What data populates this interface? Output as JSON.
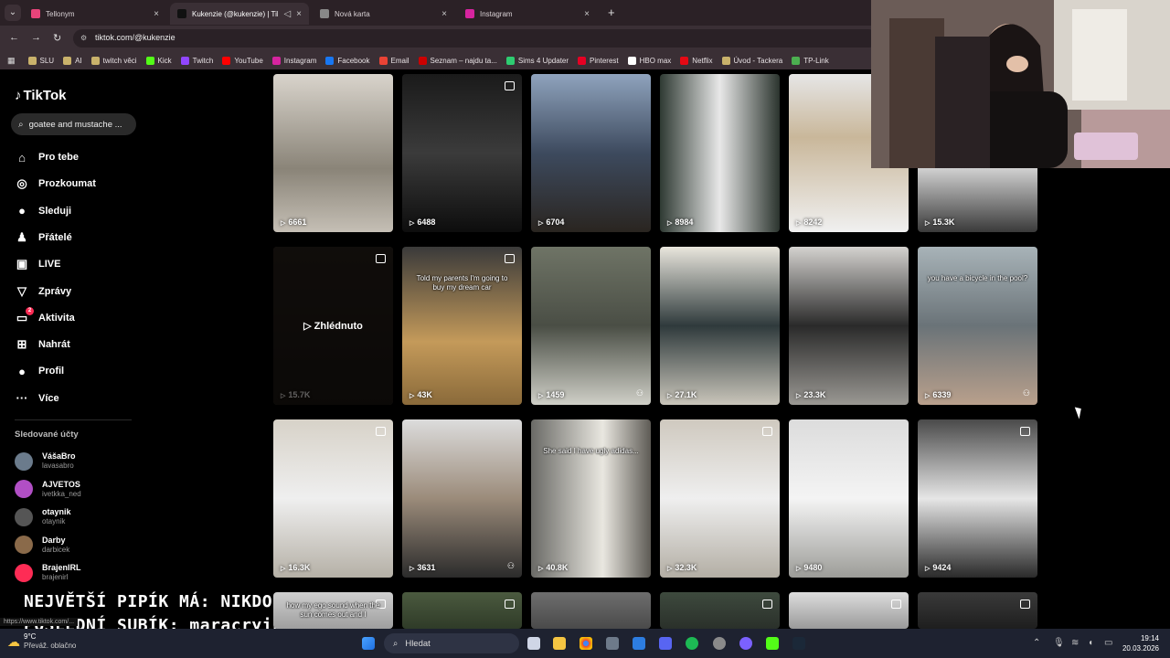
{
  "browser": {
    "tabs": [
      {
        "title": "Tellonym",
        "color": "#e8447a",
        "active": false
      },
      {
        "title": "Kukenzie (@kukenzie) | Tik",
        "color": "#111111",
        "active": true
      },
      {
        "title": "Nová karta",
        "color": "#888888",
        "active": false
      },
      {
        "title": "Instagram",
        "color": "#d6249f",
        "active": false
      }
    ],
    "url": "tiktok.com/@kukenzie",
    "bookmarks": [
      {
        "label": "SLU",
        "color": "#c9b26b"
      },
      {
        "label": "AI",
        "color": "#c9b26b"
      },
      {
        "label": "twitch věci",
        "color": "#c9b26b"
      },
      {
        "label": "Kick",
        "color": "#53fc18"
      },
      {
        "label": "Twitch",
        "color": "#9146ff"
      },
      {
        "label": "YouTube",
        "color": "#ff0000"
      },
      {
        "label": "Instagram",
        "color": "#d6249f"
      },
      {
        "label": "Facebook",
        "color": "#1877f2"
      },
      {
        "label": "Email",
        "color": "#ea4335"
      },
      {
        "label": "Seznam – najdu ta...",
        "color": "#cc0000"
      },
      {
        "label": "Sims 4 Updater",
        "color": "#2ecc71"
      },
      {
        "label": "Pinterest",
        "color": "#e60023"
      },
      {
        "label": "HBO max",
        "color": "#ffffff"
      },
      {
        "label": "Netflix",
        "color": "#e50914"
      },
      {
        "label": "Úvod - Tackera",
        "color": "#c9b26b"
      },
      {
        "label": "TP-Link",
        "color": "#4caf50"
      }
    ]
  },
  "tiktok": {
    "logo": "TikTok",
    "search_value": "goatee and mustache ...",
    "nav": [
      {
        "label": "Pro tebe",
        "icon": "home-icon",
        "glyph": "⌂"
      },
      {
        "label": "Prozkoumat",
        "icon": "compass-icon",
        "glyph": "◎"
      },
      {
        "label": "Sleduji",
        "icon": "avatar-icon",
        "glyph": "●"
      },
      {
        "label": "Přátelé",
        "icon": "friends-icon",
        "glyph": "♟"
      },
      {
        "label": "LIVE",
        "icon": "live-icon",
        "glyph": "▣"
      },
      {
        "label": "Zprávy",
        "icon": "send-icon",
        "glyph": "▽"
      },
      {
        "label": "Aktivita",
        "icon": "activity-icon",
        "glyph": "▭",
        "badge": "2"
      },
      {
        "label": "Nahrát",
        "icon": "upload-icon",
        "glyph": "⊞"
      },
      {
        "label": "Profil",
        "icon": "profile-icon",
        "glyph": "●"
      },
      {
        "label": "Více",
        "icon": "more-icon",
        "glyph": "···"
      }
    ],
    "following_heading": "Sledované účty",
    "following": [
      {
        "name": "VášaBro",
        "handle": "lavasabro",
        "color": "#6b7b8c"
      },
      {
        "name": "AJVETOS",
        "handle": "ivetkka_ned",
        "color": "#b14fc5"
      },
      {
        "name": "otaynik",
        "handle": "otaynik",
        "color": "#555555"
      },
      {
        "name": "Darby",
        "handle": "darbicek",
        "color": "#8a6a4a"
      },
      {
        "name": "BrajenIRL",
        "handle": "brajenirl",
        "color": "#fe2c55"
      }
    ],
    "videos": [
      {
        "plays": "6661",
        "bg": "linear-gradient(180deg,#d9d4cc,#8a8478 60%,#c5bfb5)",
        "caption": "",
        "pinned": false,
        "collab": false
      },
      {
        "plays": "6488",
        "bg": "linear-gradient(180deg,#1a1a1a,#3b3b3b 50%,#0d0d0d)",
        "caption": "",
        "pinned": true,
        "collab": false
      },
      {
        "plays": "6704",
        "bg": "linear-gradient(180deg,#8fa3bd,#3d4a5e 50%,#2a2520)",
        "caption": "",
        "pinned": false,
        "collab": false
      },
      {
        "plays": "8984",
        "bg": "linear-gradient(90deg,#2f3a33,#e8e8e8 50%,#2b342e)",
        "caption": "",
        "pinned": false,
        "collab": false
      },
      {
        "plays": "8242",
        "bg": "linear-gradient(180deg,#e6e6e6,#c9b79a 40%,#f0f0f0)",
        "caption": "",
        "pinned": false,
        "collab": false
      },
      {
        "plays": "15.3K",
        "bg": "linear-gradient(180deg,#2a2a2a,#cfcfcf 60%,#3a3a3a)",
        "caption": "",
        "pinned": false,
        "collab": false
      },
      {
        "plays": "15.7K",
        "bg": "linear-gradient(180deg,#3a3028,#2a231c)",
        "caption": "",
        "pinned": true,
        "collab": false,
        "watched": "Zhlédnuto"
      },
      {
        "plays": "43K",
        "bg": "linear-gradient(180deg,#3a3a3a,#c49a5a 60%,#8a6a3a)",
        "caption": "Told my parents I'm going to buy my dream car",
        "pinned": true,
        "collab": false
      },
      {
        "plays": "1459",
        "bg": "linear-gradient(180deg,#6f7466,#4a4e45 50%,#cfcfc7)",
        "caption": "",
        "pinned": false,
        "collab": true
      },
      {
        "plays": "27.1K",
        "bg": "linear-gradient(180deg,#e9e6dd,#2f3a3c 50%,#c9c5ba)",
        "caption": "",
        "pinned": false,
        "collab": false
      },
      {
        "plays": "23.3K",
        "bg": "linear-gradient(180deg,#d4d2cf,#2a2a2a 50%,#9a9893)",
        "caption": "",
        "pinned": false,
        "collab": false
      },
      {
        "plays": "6339",
        "bg": "linear-gradient(180deg,#a8b3b8,#6a7378 50%,#b9a08c)",
        "caption": "you have a bicycle in the pool?",
        "pinned": false,
        "collab": true
      },
      {
        "plays": "16.3K",
        "bg": "linear-gradient(180deg,#d7d2c8,#efefef 50%,#b5b0a6)",
        "caption": "",
        "pinned": true,
        "collab": false
      },
      {
        "plays": "3631",
        "bg": "linear-gradient(180deg,#dcdcdc,#9b8b7a 50%,#2b2b2b)",
        "caption": "",
        "pinned": false,
        "collab": true
      },
      {
        "plays": "40.8K",
        "bg": "linear-gradient(90deg,#6a6a66,#e9e7e0 60%,#5e5b55)",
        "caption": "She said I have ugly adidas...",
        "pinned": false,
        "collab": false
      },
      {
        "plays": "32.3K",
        "bg": "linear-gradient(180deg,#cfc9bf,#efefef 50%,#b3aea4)",
        "caption": "",
        "pinned": true,
        "collab": false
      },
      {
        "plays": "9480",
        "bg": "linear-gradient(180deg,#dcdcdc,#f4f4f4 50%,#9c9c98)",
        "caption": "",
        "pinned": false,
        "collab": false
      },
      {
        "plays": "9424",
        "bg": "linear-gradient(180deg,#4a4a4a,#e6e6e6 50%,#2a2a2a)",
        "caption": "",
        "pinned": true,
        "collab": false
      },
      {
        "plays": "",
        "bg": "linear-gradient(180deg,#cfcfcf,#9e9e9e)",
        "caption": "how my ego sound when the sun comes out and I",
        "pinned": true,
        "collab": false
      },
      {
        "plays": "",
        "bg": "linear-gradient(180deg,#4b5a3f,#2f3b28)",
        "caption": "",
        "pinned": true,
        "collab": false
      },
      {
        "plays": "",
        "bg": "linear-gradient(180deg,#6e6e6e,#4a4a4a)",
        "caption": "",
        "pinned": false,
        "collab": false
      },
      {
        "plays": "",
        "bg": "linear-gradient(180deg,#3e4a3e,#2a302a)",
        "caption": "",
        "pinned": true,
        "collab": false
      },
      {
        "plays": "",
        "bg": "linear-gradient(180deg,#dddddd,#9a9a9a)",
        "caption": "",
        "pinned": true,
        "collab": false
      },
      {
        "plays": "",
        "bg": "linear-gradient(180deg,#3a3a3a,#1e1e1e)",
        "caption": "",
        "pinned": true,
        "collab": false
      }
    ]
  },
  "overlay": {
    "line1": "NEJVĚTŠÍ PIPÍK MÁ: NIKDO",
    "line2": "POSLEDNÍ SUBÍK: maracrying"
  },
  "statusbar": "https://www.tiktok.com/...",
  "taskbar": {
    "weather_temp": "9°C",
    "weather_desc": "Převáž. oblačno",
    "search_label": "Hledat",
    "time": "19:14",
    "date": "20.03.2026"
  }
}
